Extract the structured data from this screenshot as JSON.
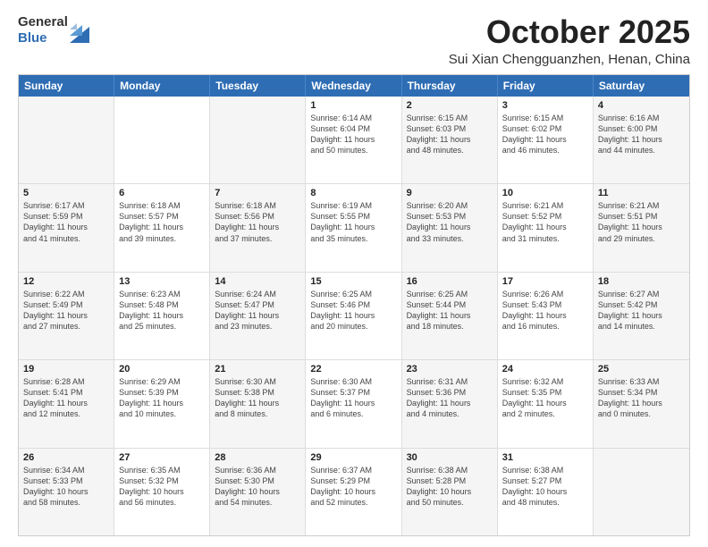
{
  "logo": {
    "general": "General",
    "blue": "Blue"
  },
  "header": {
    "month": "October 2025",
    "location": "Sui Xian Chengguanzhen, Henan, China"
  },
  "days": [
    "Sunday",
    "Monday",
    "Tuesday",
    "Wednesday",
    "Thursday",
    "Friday",
    "Saturday"
  ],
  "weeks": [
    [
      {
        "day": "",
        "text": ""
      },
      {
        "day": "",
        "text": ""
      },
      {
        "day": "",
        "text": ""
      },
      {
        "day": "1",
        "text": "Sunrise: 6:14 AM\nSunset: 6:04 PM\nDaylight: 11 hours\nand 50 minutes."
      },
      {
        "day": "2",
        "text": "Sunrise: 6:15 AM\nSunset: 6:03 PM\nDaylight: 11 hours\nand 48 minutes."
      },
      {
        "day": "3",
        "text": "Sunrise: 6:15 AM\nSunset: 6:02 PM\nDaylight: 11 hours\nand 46 minutes."
      },
      {
        "day": "4",
        "text": "Sunrise: 6:16 AM\nSunset: 6:00 PM\nDaylight: 11 hours\nand 44 minutes."
      }
    ],
    [
      {
        "day": "5",
        "text": "Sunrise: 6:17 AM\nSunset: 5:59 PM\nDaylight: 11 hours\nand 41 minutes."
      },
      {
        "day": "6",
        "text": "Sunrise: 6:18 AM\nSunset: 5:57 PM\nDaylight: 11 hours\nand 39 minutes."
      },
      {
        "day": "7",
        "text": "Sunrise: 6:18 AM\nSunset: 5:56 PM\nDaylight: 11 hours\nand 37 minutes."
      },
      {
        "day": "8",
        "text": "Sunrise: 6:19 AM\nSunset: 5:55 PM\nDaylight: 11 hours\nand 35 minutes."
      },
      {
        "day": "9",
        "text": "Sunrise: 6:20 AM\nSunset: 5:53 PM\nDaylight: 11 hours\nand 33 minutes."
      },
      {
        "day": "10",
        "text": "Sunrise: 6:21 AM\nSunset: 5:52 PM\nDaylight: 11 hours\nand 31 minutes."
      },
      {
        "day": "11",
        "text": "Sunrise: 6:21 AM\nSunset: 5:51 PM\nDaylight: 11 hours\nand 29 minutes."
      }
    ],
    [
      {
        "day": "12",
        "text": "Sunrise: 6:22 AM\nSunset: 5:49 PM\nDaylight: 11 hours\nand 27 minutes."
      },
      {
        "day": "13",
        "text": "Sunrise: 6:23 AM\nSunset: 5:48 PM\nDaylight: 11 hours\nand 25 minutes."
      },
      {
        "day": "14",
        "text": "Sunrise: 6:24 AM\nSunset: 5:47 PM\nDaylight: 11 hours\nand 23 minutes."
      },
      {
        "day": "15",
        "text": "Sunrise: 6:25 AM\nSunset: 5:46 PM\nDaylight: 11 hours\nand 20 minutes."
      },
      {
        "day": "16",
        "text": "Sunrise: 6:25 AM\nSunset: 5:44 PM\nDaylight: 11 hours\nand 18 minutes."
      },
      {
        "day": "17",
        "text": "Sunrise: 6:26 AM\nSunset: 5:43 PM\nDaylight: 11 hours\nand 16 minutes."
      },
      {
        "day": "18",
        "text": "Sunrise: 6:27 AM\nSunset: 5:42 PM\nDaylight: 11 hours\nand 14 minutes."
      }
    ],
    [
      {
        "day": "19",
        "text": "Sunrise: 6:28 AM\nSunset: 5:41 PM\nDaylight: 11 hours\nand 12 minutes."
      },
      {
        "day": "20",
        "text": "Sunrise: 6:29 AM\nSunset: 5:39 PM\nDaylight: 11 hours\nand 10 minutes."
      },
      {
        "day": "21",
        "text": "Sunrise: 6:30 AM\nSunset: 5:38 PM\nDaylight: 11 hours\nand 8 minutes."
      },
      {
        "day": "22",
        "text": "Sunrise: 6:30 AM\nSunset: 5:37 PM\nDaylight: 11 hours\nand 6 minutes."
      },
      {
        "day": "23",
        "text": "Sunrise: 6:31 AM\nSunset: 5:36 PM\nDaylight: 11 hours\nand 4 minutes."
      },
      {
        "day": "24",
        "text": "Sunrise: 6:32 AM\nSunset: 5:35 PM\nDaylight: 11 hours\nand 2 minutes."
      },
      {
        "day": "25",
        "text": "Sunrise: 6:33 AM\nSunset: 5:34 PM\nDaylight: 11 hours\nand 0 minutes."
      }
    ],
    [
      {
        "day": "26",
        "text": "Sunrise: 6:34 AM\nSunset: 5:33 PM\nDaylight: 10 hours\nand 58 minutes."
      },
      {
        "day": "27",
        "text": "Sunrise: 6:35 AM\nSunset: 5:32 PM\nDaylight: 10 hours\nand 56 minutes."
      },
      {
        "day": "28",
        "text": "Sunrise: 6:36 AM\nSunset: 5:30 PM\nDaylight: 10 hours\nand 54 minutes."
      },
      {
        "day": "29",
        "text": "Sunrise: 6:37 AM\nSunset: 5:29 PM\nDaylight: 10 hours\nand 52 minutes."
      },
      {
        "day": "30",
        "text": "Sunrise: 6:38 AM\nSunset: 5:28 PM\nDaylight: 10 hours\nand 50 minutes."
      },
      {
        "day": "31",
        "text": "Sunrise: 6:38 AM\nSunset: 5:27 PM\nDaylight: 10 hours\nand 48 minutes."
      },
      {
        "day": "",
        "text": ""
      }
    ]
  ]
}
